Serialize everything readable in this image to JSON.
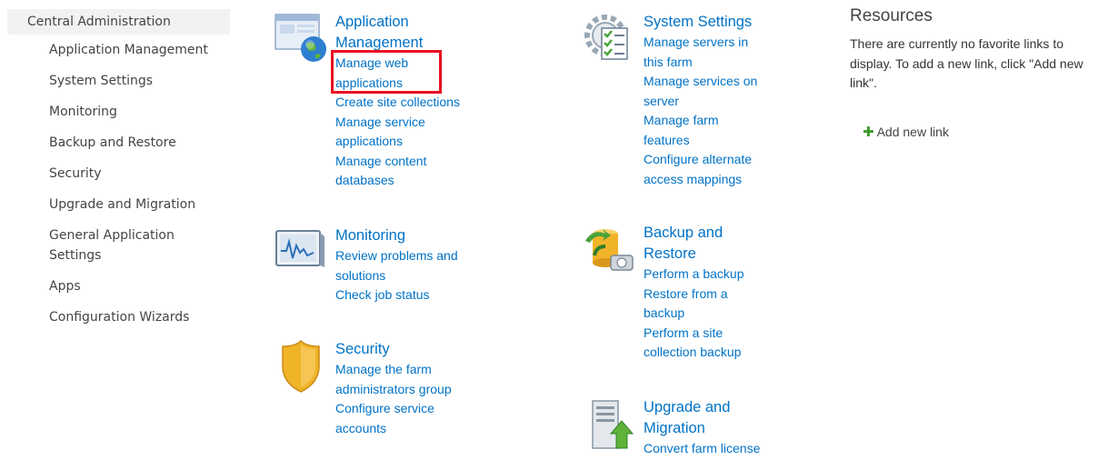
{
  "leftnav": {
    "top": "Central Administration",
    "items": [
      {
        "label": "Application Management"
      },
      {
        "label": "System Settings"
      },
      {
        "label": "Monitoring"
      },
      {
        "label": "Backup and Restore"
      },
      {
        "label": "Security"
      },
      {
        "label": "Upgrade and Migration"
      },
      {
        "label": "General Application Settings"
      },
      {
        "label": "Apps"
      },
      {
        "label": "Configuration Wizards"
      }
    ]
  },
  "sections": {
    "app_mgmt": {
      "icon": "web-application-globe-icon",
      "title": "Application Management",
      "links": [
        "Manage web applications",
        "Create site collections",
        "Manage service applications",
        "Manage content databases"
      ]
    },
    "monitoring": {
      "icon": "monitoring-chart-icon",
      "title": "Monitoring",
      "links": [
        "Review problems and solutions",
        "Check job status"
      ]
    },
    "security": {
      "icon": "security-shield-icon",
      "title": "Security",
      "links": [
        "Manage the farm administrators group",
        "Configure service accounts"
      ]
    },
    "system_settings": {
      "icon": "system-settings-gear-icon",
      "title": "System Settings",
      "links": [
        "Manage servers in this farm",
        "Manage services on server",
        "Manage farm features",
        "Configure alternate access mappings"
      ]
    },
    "backup": {
      "icon": "backup-restore-icon",
      "title": "Backup and Restore",
      "links": [
        "Perform a backup",
        "Restore from a backup",
        "Perform a site collection backup"
      ]
    },
    "upgrade": {
      "icon": "upgrade-migration-server-icon",
      "title": "Upgrade and Migration",
      "links": [
        "Convert farm license"
      ]
    }
  },
  "resources": {
    "title": "Resources",
    "message": "There are currently no favorite links to display. To add a new link, click \"Add new link\".",
    "add_link": "Add new link",
    "add_icon": "plus-icon"
  },
  "colors": {
    "link": "#0072c6",
    "highlight": "#e81123",
    "nav_bg": "#f3f2f1"
  }
}
